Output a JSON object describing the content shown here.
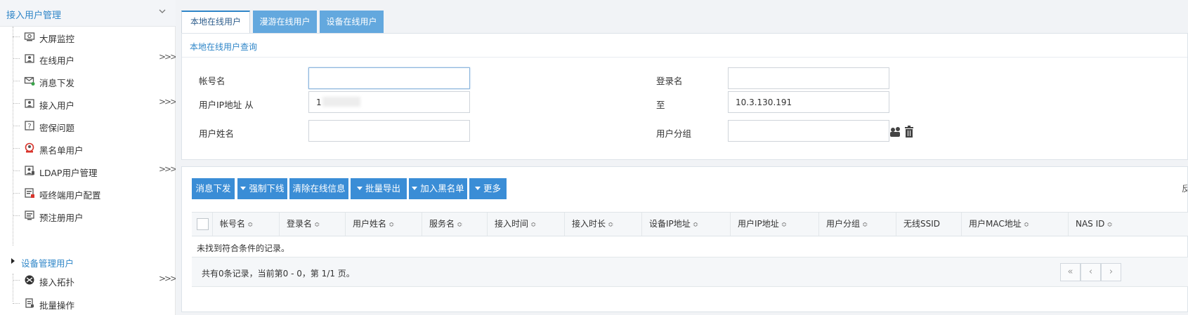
{
  "sidebar": {
    "header": "接入用户管理",
    "items": [
      {
        "label": "大屏监控",
        "icon": "monitor-icon",
        "more": ""
      },
      {
        "label": "在线用户",
        "icon": "online-user-icon",
        "more": ">>>"
      },
      {
        "label": "消息下发",
        "icon": "message-icon",
        "more": ""
      },
      {
        "label": "接入用户",
        "icon": "access-user-icon",
        "more": ">>>"
      },
      {
        "label": "密保问题",
        "icon": "security-question-icon",
        "more": ""
      },
      {
        "label": "黑名单用户",
        "icon": "blacklist-icon",
        "more": ""
      },
      {
        "label": "LDAP用户管理",
        "icon": "ldap-icon",
        "more": ">>>"
      },
      {
        "label": "哑终端用户配置",
        "icon": "dumb-terminal-icon",
        "more": ""
      },
      {
        "label": "预注册用户",
        "icon": "preregister-icon",
        "more": ""
      }
    ],
    "section": "设备管理用户",
    "section_items": [
      {
        "label": "接入拓扑",
        "icon": "topology-icon",
        "more": ">>>"
      },
      {
        "label": "批量操作",
        "icon": "batch-icon",
        "more": ""
      }
    ]
  },
  "tabs": [
    "本地在线用户",
    "漫游在线用户",
    "设备在线用户"
  ],
  "query": {
    "title": "本地在线用户查询",
    "account_label": "帐号名",
    "login_label": "登录名",
    "ip_from_label": "用户IP地址 从",
    "ip_from_value": "1",
    "ip_to_label": "至",
    "ip_to_value": "10.3.130.191",
    "name_label": "用户姓名",
    "group_label": "用户分组"
  },
  "toolbar": {
    "message": "消息下发",
    "force_offline": "强制下线",
    "clear_online": "清除在线信息",
    "batch_export": "批量导出",
    "add_blacklist": "加入黑名单",
    "more": "更多",
    "edge_text": "反"
  },
  "table": {
    "columns": [
      "帐号名",
      "登录名",
      "用户姓名",
      "服务名",
      "接入时间",
      "接入时长",
      "设备IP地址",
      "用户IP地址",
      "用户分组",
      "无线SSID",
      "用户MAC地址",
      "NAS ID"
    ],
    "sort_glyph": "≎",
    "empty": "未找到符合条件的记录。",
    "summary": "共有0条记录，当前第0 - 0，第 1/1 页。",
    "pager": [
      "«",
      "‹",
      "›"
    ]
  },
  "colors": {
    "accent": "#2f86c8",
    "button": "#3a8dd6",
    "tab_inactive": "#63a8de"
  }
}
